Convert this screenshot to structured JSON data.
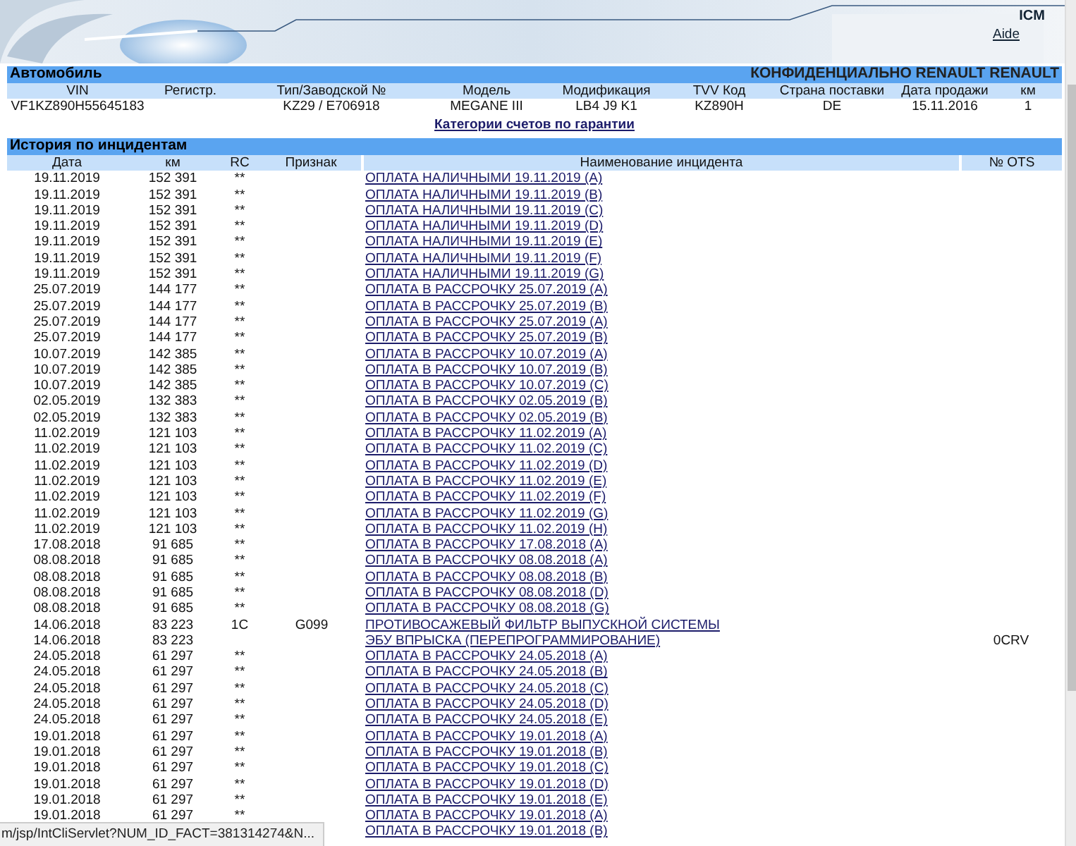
{
  "header": {
    "app_name": "ICM",
    "help_link": "Aide"
  },
  "vehicle": {
    "title": "Автомобиль",
    "confidential": "КОНФИДЕНЦИАЛЬНО RENAULT RENAULT",
    "fields": [
      {
        "label": "VIN",
        "value": "VF1KZ890H55645183"
      },
      {
        "label": "Регистр."
      },
      {
        "label": "Тип/Заводской №",
        "value": "KZ29 / E706918"
      },
      {
        "label": "Модель",
        "value": "MEGANE III"
      },
      {
        "label": "Модификация",
        "value": "LB4 J9 K1"
      },
      {
        "label": "TVV Код",
        "value": "KZ890H"
      },
      {
        "label": "Страна поставки",
        "value": "DE"
      },
      {
        "label": "Дата продажи",
        "value": "15.11.2016"
      },
      {
        "label": "км",
        "value": "1"
      }
    ],
    "warranty_link": "Категории счетов по гарантии"
  },
  "incidents": {
    "title": "История по инцидентам",
    "columns": [
      "Дата",
      "км",
      "RC",
      "Признак",
      "Наименование инцидента",
      "№ OTS"
    ],
    "rows": [
      {
        "date": "19.11.2019",
        "km": "152 391",
        "rc": "**",
        "name": "ОПЛАТА НАЛИЧНЫМИ 19.11.2019 (A)"
      },
      {
        "date": "19.11.2019",
        "km": "152 391",
        "rc": "**",
        "name": "ОПЛАТА НАЛИЧНЫМИ 19.11.2019 (B)"
      },
      {
        "date": "19.11.2019",
        "km": "152 391",
        "rc": "**",
        "name": "ОПЛАТА НАЛИЧНЫМИ 19.11.2019 (C)"
      },
      {
        "date": "19.11.2019",
        "km": "152 391",
        "rc": "**",
        "name": "ОПЛАТА НАЛИЧНЫМИ 19.11.2019 (D)"
      },
      {
        "date": "19.11.2019",
        "km": "152 391",
        "rc": "**",
        "name": "ОПЛАТА НАЛИЧНЫМИ 19.11.2019 (E)"
      },
      {
        "date": "19.11.2019",
        "km": "152 391",
        "rc": "**",
        "name": "ОПЛАТА НАЛИЧНЫМИ 19.11.2019 (F)"
      },
      {
        "date": "19.11.2019",
        "km": "152 391",
        "rc": "**",
        "name": "ОПЛАТА НАЛИЧНЫМИ 19.11.2019 (G)"
      },
      {
        "date": "25.07.2019",
        "km": "144 177",
        "rc": "**",
        "name": "ОПЛАТА В РАССРОЧКУ 25.07.2019 (A)"
      },
      {
        "date": "25.07.2019",
        "km": "144 177",
        "rc": "**",
        "name": "ОПЛАТА В РАССРОЧКУ 25.07.2019 (B)"
      },
      {
        "date": "25.07.2019",
        "km": "144 177",
        "rc": "**",
        "name": "ОПЛАТА В РАССРОЧКУ 25.07.2019 (A)"
      },
      {
        "date": "25.07.2019",
        "km": "144 177",
        "rc": "**",
        "name": "ОПЛАТА В РАССРОЧКУ 25.07.2019 (B)"
      },
      {
        "date": "10.07.2019",
        "km": "142 385",
        "rc": "**",
        "name": "ОПЛАТА В РАССРОЧКУ 10.07.2019 (A)"
      },
      {
        "date": "10.07.2019",
        "km": "142 385",
        "rc": "**",
        "name": "ОПЛАТА В РАССРОЧКУ 10.07.2019 (B)"
      },
      {
        "date": "10.07.2019",
        "km": "142 385",
        "rc": "**",
        "name": "ОПЛАТА В РАССРОЧКУ 10.07.2019 (C)"
      },
      {
        "date": "02.05.2019",
        "km": "132 383",
        "rc": "**",
        "name": "ОПЛАТА В РАССРОЧКУ 02.05.2019 (B)"
      },
      {
        "date": "02.05.2019",
        "km": "132 383",
        "rc": "**",
        "name": "ОПЛАТА В РАССРОЧКУ 02.05.2019 (B)"
      },
      {
        "date": "11.02.2019",
        "km": "121 103",
        "rc": "**",
        "name": "ОПЛАТА В РАССРОЧКУ 11.02.2019 (A)"
      },
      {
        "date": "11.02.2019",
        "km": "121 103",
        "rc": "**",
        "name": "ОПЛАТА В РАССРОЧКУ 11.02.2019 (C)"
      },
      {
        "date": "11.02.2019",
        "km": "121 103",
        "rc": "**",
        "name": "ОПЛАТА В РАССРОЧКУ 11.02.2019 (D)"
      },
      {
        "date": "11.02.2019",
        "km": "121 103",
        "rc": "**",
        "name": "ОПЛАТА В РАССРОЧКУ 11.02.2019 (E)"
      },
      {
        "date": "11.02.2019",
        "km": "121 103",
        "rc": "**",
        "name": "ОПЛАТА В РАССРОЧКУ 11.02.2019 (F)"
      },
      {
        "date": "11.02.2019",
        "km": "121 103",
        "rc": "**",
        "name": "ОПЛАТА В РАССРОЧКУ 11.02.2019 (G)"
      },
      {
        "date": "11.02.2019",
        "km": "121 103",
        "rc": "**",
        "name": "ОПЛАТА В РАССРОЧКУ 11.02.2019 (H)"
      },
      {
        "date": "17.08.2018",
        "km": "91 685",
        "rc": "**",
        "name": "ОПЛАТА В РАССРОЧКУ 17.08.2018 (A)"
      },
      {
        "date": "08.08.2018",
        "km": "91 685",
        "rc": "**",
        "name": "ОПЛАТА В РАССРОЧКУ 08.08.2018 (A)"
      },
      {
        "date": "08.08.2018",
        "km": "91 685",
        "rc": "**",
        "name": "ОПЛАТА В РАССРОЧКУ 08.08.2018 (B)"
      },
      {
        "date": "08.08.2018",
        "km": "91 685",
        "rc": "**",
        "name": "ОПЛАТА В РАССРОЧКУ 08.08.2018 (D)"
      },
      {
        "date": "08.08.2018",
        "km": "91 685",
        "rc": "**",
        "name": "ОПЛАТА В РАССРОЧКУ 08.08.2018 (G)"
      },
      {
        "date": "14.06.2018",
        "km": "83 223",
        "rc": "1C",
        "sign": "G099",
        "name": "ПРОТИВОСАЖЕВЫЙ ФИЛЬТР ВЫПУСКНОЙ СИСТЕМЫ"
      },
      {
        "date": "14.06.2018",
        "km": "83 223",
        "name": "ЭБУ ВПРЫСКА (ПЕРЕПРОГРАММИРОВАНИЕ)",
        "ots": "0CRV"
      },
      {
        "date": "24.05.2018",
        "km": "61 297",
        "rc": "**",
        "name": "ОПЛАТА В РАССРОЧКУ 24.05.2018 (A)"
      },
      {
        "date": "24.05.2018",
        "km": "61 297",
        "rc": "**",
        "name": "ОПЛАТА В РАССРОЧКУ 24.05.2018 (B)"
      },
      {
        "date": "24.05.2018",
        "km": "61 297",
        "rc": "**",
        "name": "ОПЛАТА В РАССРОЧКУ 24.05.2018 (C)"
      },
      {
        "date": "24.05.2018",
        "km": "61 297",
        "rc": "**",
        "name": "ОПЛАТА В РАССРОЧКУ 24.05.2018 (D)"
      },
      {
        "date": "24.05.2018",
        "km": "61 297",
        "rc": "**",
        "name": "ОПЛАТА В РАССРОЧКУ 24.05.2018 (E)"
      },
      {
        "date": "19.01.2018",
        "km": "61 297",
        "rc": "**",
        "name": "ОПЛАТА В РАССРОЧКУ 19.01.2018 (A)"
      },
      {
        "date": "19.01.2018",
        "km": "61 297",
        "rc": "**",
        "name": "ОПЛАТА В РАССРОЧКУ 19.01.2018 (B)"
      },
      {
        "date": "19.01.2018",
        "km": "61 297",
        "rc": "**",
        "name": "ОПЛАТА В РАССРОЧКУ 19.01.2018 (C)"
      },
      {
        "date": "19.01.2018",
        "km": "61 297",
        "rc": "**",
        "name": "ОПЛАТА В РАССРОЧКУ 19.01.2018 (D)"
      },
      {
        "date": "19.01.2018",
        "km": "61 297",
        "rc": "**",
        "name": "ОПЛАТА В РАССРОЧКУ 19.01.2018 (E)"
      },
      {
        "date": "19.01.2018",
        "km": "61 297",
        "rc": "**",
        "name": "ОПЛАТА В РАССРОЧКУ 19.01.2018 (A)"
      },
      {
        "name": "ОПЛАТА В РАССРОЧКУ 19.01.2018 (B)"
      }
    ]
  },
  "status_bar": {
    "url": "m/jsp/IntCliServlet?NUM_ID_FACT=381314274&N..."
  }
}
